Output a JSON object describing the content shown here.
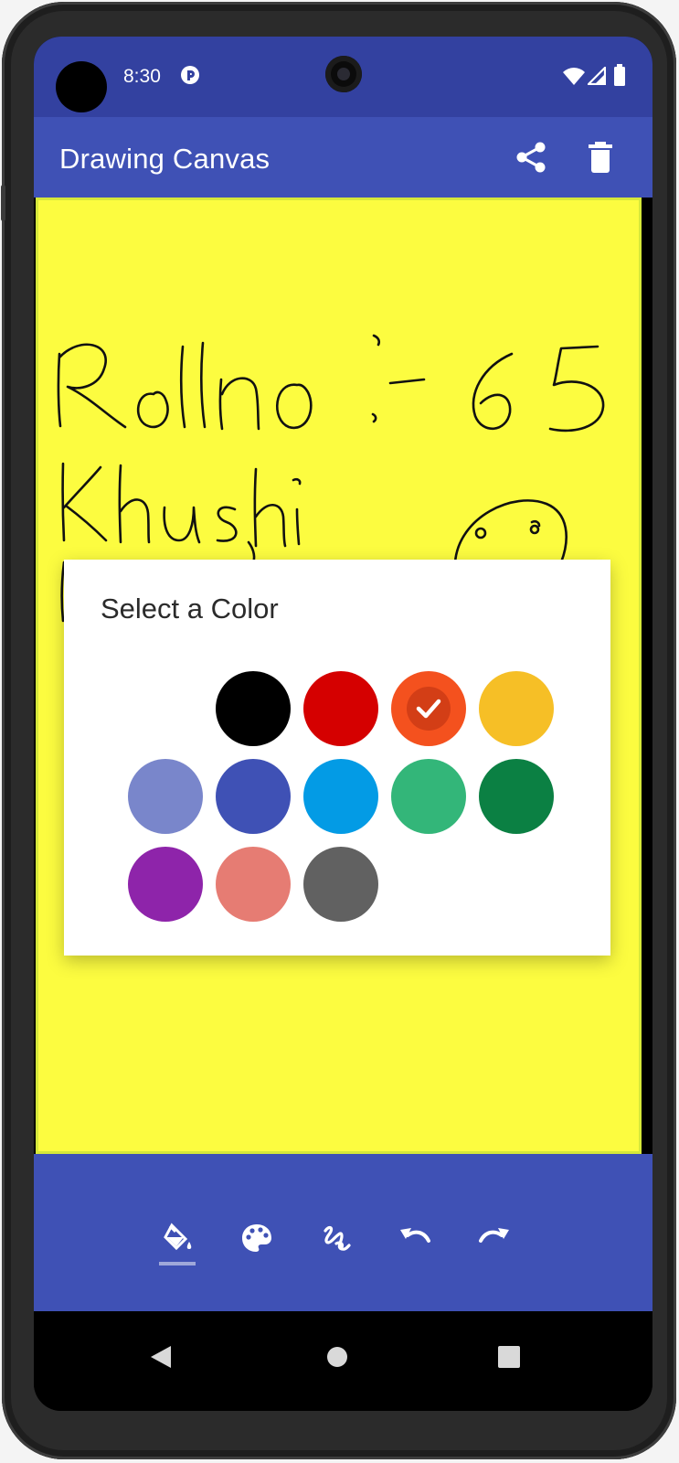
{
  "status_bar": {
    "time": "8:30"
  },
  "app_bar": {
    "title": "Drawing Canvas"
  },
  "canvas": {
    "background": "#fcfc40"
  },
  "dialog": {
    "title": "Select a Color",
    "selected": "#f4511e",
    "colors": [
      "#000000",
      "#d50000",
      "#f4511e",
      "#f6bf26",
      "#7986cb",
      "#3f51b5",
      "#039be5",
      "#33b679",
      "#0b8043",
      "#8e24aa",
      "#e67c73",
      "#616161"
    ]
  },
  "toolbar": {
    "tools": [
      "fill-icon",
      "palette-icon",
      "brush-stroke-icon",
      "undo-icon",
      "redo-icon"
    ],
    "active": "fill-icon"
  }
}
